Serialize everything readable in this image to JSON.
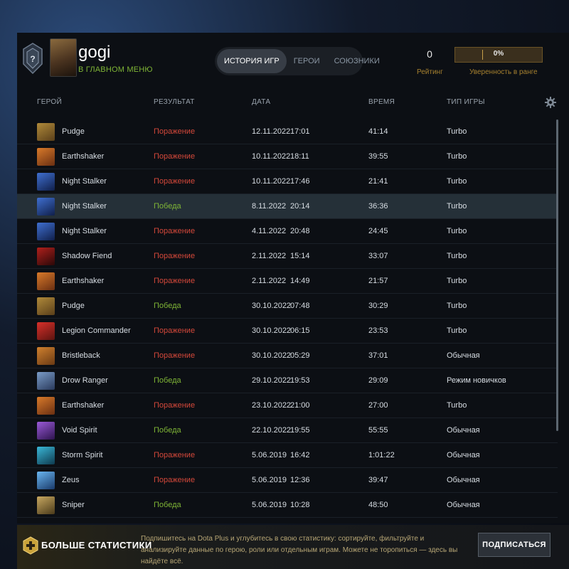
{
  "profile": {
    "username": "gogi",
    "status": "В ГЛАВНОМ МЕНЮ",
    "rank_badge_icon": "rank-unknown-icon"
  },
  "tabs": [
    {
      "label": "ИСТОРИЯ ИГР",
      "active": true
    },
    {
      "label": "ГЕРОИ",
      "active": false
    },
    {
      "label": "СОЮЗНИКИ",
      "active": false
    }
  ],
  "stats": {
    "rating_value": "0",
    "rating_label": "Рейтинг",
    "confidence_value": "0%",
    "confidence_fraction": 0.0,
    "confidence_label": "Уверенность в ранге"
  },
  "table": {
    "headers": {
      "hero": "ГЕРОЙ",
      "result": "РЕЗУЛЬТАТ",
      "date": "ДАТА",
      "duration": "ВРЕМЯ",
      "mode": "ТИП ИГРЫ"
    },
    "settings_icon": "gear-icon",
    "rows": [
      {
        "hero": "Pudge",
        "result": "Поражение",
        "outcome": "loss",
        "date": "12.11.2022",
        "time": "17:01",
        "duration": "41:14",
        "mode": "Turbo",
        "icon_colors": [
          "#b08a3a",
          "#5a3f1a"
        ]
      },
      {
        "hero": "Earthshaker",
        "result": "Поражение",
        "outcome": "loss",
        "date": "10.11.2022",
        "time": "18:11",
        "duration": "39:55",
        "mode": "Turbo",
        "icon_colors": [
          "#d97a2a",
          "#6a2f12"
        ]
      },
      {
        "hero": "Night Stalker",
        "result": "Поражение",
        "outcome": "loss",
        "date": "10.11.2022",
        "time": "17:46",
        "duration": "21:41",
        "mode": "Turbo",
        "icon_colors": [
          "#3f6fd0",
          "#101f4a"
        ]
      },
      {
        "hero": "Night Stalker",
        "result": "Победа",
        "outcome": "win",
        "date": "8.11.2022",
        "time": "20:14",
        "duration": "36:36",
        "mode": "Turbo",
        "icon_colors": [
          "#3f6fd0",
          "#101f4a"
        ]
      },
      {
        "hero": "Night Stalker",
        "result": "Поражение",
        "outcome": "loss",
        "date": "4.11.2022",
        "time": "20:48",
        "duration": "24:45",
        "mode": "Turbo",
        "icon_colors": [
          "#3f6fd0",
          "#101f4a"
        ]
      },
      {
        "hero": "Shadow Fiend",
        "result": "Поражение",
        "outcome": "loss",
        "date": "2.11.2022",
        "time": "15:14",
        "duration": "33:07",
        "mode": "Turbo",
        "icon_colors": [
          "#b0201c",
          "#2a0808"
        ]
      },
      {
        "hero": "Earthshaker",
        "result": "Поражение",
        "outcome": "loss",
        "date": "2.11.2022",
        "time": "14:49",
        "duration": "21:57",
        "mode": "Turbo",
        "icon_colors": [
          "#d97a2a",
          "#6a2f12"
        ]
      },
      {
        "hero": "Pudge",
        "result": "Победа",
        "outcome": "win",
        "date": "30.10.2022",
        "time": "07:48",
        "duration": "30:29",
        "mode": "Turbo",
        "icon_colors": [
          "#b08a3a",
          "#5a3f1a"
        ]
      },
      {
        "hero": "Legion Commander",
        "result": "Поражение",
        "outcome": "loss",
        "date": "30.10.2022",
        "time": "06:15",
        "duration": "23:53",
        "mode": "Turbo",
        "icon_colors": [
          "#d8302a",
          "#5c1410"
        ]
      },
      {
        "hero": "Bristleback",
        "result": "Поражение",
        "outcome": "loss",
        "date": "30.10.2022",
        "time": "05:29",
        "duration": "37:01",
        "mode": "Обычная",
        "icon_colors": [
          "#d0802e",
          "#6a3a14"
        ]
      },
      {
        "hero": "Drow Ranger",
        "result": "Победа",
        "outcome": "win",
        "date": "29.10.2022",
        "time": "19:53",
        "duration": "29:09",
        "mode": "Режим новичков",
        "icon_colors": [
          "#7a9cc8",
          "#2a3a5c"
        ]
      },
      {
        "hero": "Earthshaker",
        "result": "Поражение",
        "outcome": "loss",
        "date": "23.10.2022",
        "time": "21:00",
        "duration": "27:00",
        "mode": "Turbo",
        "icon_colors": [
          "#d97a2a",
          "#6a2f12"
        ]
      },
      {
        "hero": "Void Spirit",
        "result": "Победа",
        "outcome": "win",
        "date": "22.10.2022",
        "time": "19:55",
        "duration": "55:55",
        "mode": "Обычная",
        "icon_colors": [
          "#9a5ad8",
          "#2e144e"
        ]
      },
      {
        "hero": "Storm Spirit",
        "result": "Поражение",
        "outcome": "loss",
        "date": "5.06.2019",
        "time": "16:42",
        "duration": "1:01:22",
        "mode": "Обычная",
        "icon_colors": [
          "#3ab8d8",
          "#0e3a4e"
        ]
      },
      {
        "hero": "Zeus",
        "result": "Поражение",
        "outcome": "loss",
        "date": "5.06.2019",
        "time": "12:36",
        "duration": "39:47",
        "mode": "Обычная",
        "icon_colors": [
          "#6ab6f0",
          "#1a3a6a"
        ]
      },
      {
        "hero": "Sniper",
        "result": "Победа",
        "outcome": "win",
        "date": "5.06.2019",
        "time": "10:28",
        "duration": "48:50",
        "mode": "Обычная",
        "icon_colors": [
          "#c8a860",
          "#4a3a1a"
        ]
      }
    ]
  },
  "banner": {
    "title": "БОЛЬШЕ СТАТИСТИКИ",
    "description": "Подпишитесь на Dota Plus и углубитесь в свою статистику: сортируйте, фильтруйте и анализируйте данные по герою, роли или отдельным играм. Можете не торопиться — здесь вы найдёте всё.",
    "button_label": "ПОДПИСАТЬСЯ",
    "icon": "dota-plus-icon"
  },
  "colors": {
    "loss": "#d4483a",
    "win": "#7fb536",
    "accent_gold": "#a7812f"
  }
}
